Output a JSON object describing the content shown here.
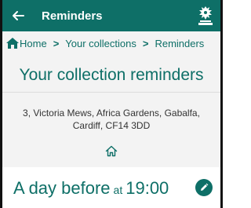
{
  "appbar": {
    "title": "Reminders",
    "back_icon": "arrow-left-icon",
    "logo": "council-crest-logo",
    "color": "#0e6f67"
  },
  "breadcrumb": {
    "home_label": "Home",
    "home_icon": "home-icon",
    "separator": ">",
    "items": [
      "Your collections",
      "Reminders"
    ]
  },
  "main": {
    "title": "Your collection reminders",
    "address": "3, Victoria Mews,  Africa Gardens, Gabalfa, Cardiff, CF14 3DD",
    "address_icon": "home-outline-icon"
  },
  "reminder": {
    "when": "A day before",
    "at": "at",
    "time": "19:00",
    "edit_icon": "pencil-icon"
  }
}
